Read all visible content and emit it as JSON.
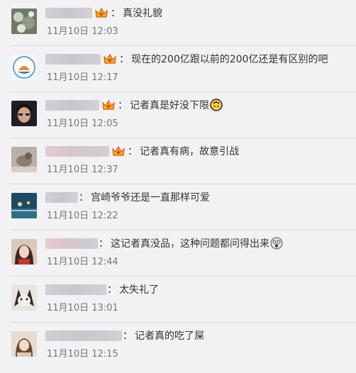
{
  "comments": [
    {
      "separator": "：",
      "text": "真没礼貌",
      "time": "11月10日 12:03",
      "badge": "vip-crown-badge",
      "emoji": ""
    },
    {
      "separator": "：",
      "text": "现在的200亿跟以前的200亿还是有区别的吧",
      "time": "11月10日 12:17",
      "badge": "vip-crown-badge",
      "emoji": ""
    },
    {
      "separator": "：",
      "text": "记者真是好没下限",
      "time": "11月10日 12:05",
      "badge": "vip-crown-badge",
      "emoji": "upside-down-face-emoji"
    },
    {
      "separator": "：",
      "text": "记者真有病，故意引战",
      "time": "11月10日 12:37",
      "badge": "vip-crown-badge",
      "emoji": ""
    },
    {
      "separator": "：",
      "text": "宫崎爷爷还是一直那样可爱",
      "time": "11月10日 12:22",
      "badge": "",
      "emoji": ""
    },
    {
      "separator": "：",
      "text": "这记者真没品，这种问题都问得出来",
      "time": "11月10日 12:44",
      "badge": "",
      "emoji": "shocked-face-emoji"
    },
    {
      "separator": "：",
      "text": "太失礼了",
      "time": "11月10日 13:01",
      "badge": "",
      "emoji": ""
    },
    {
      "separator": "：",
      "text": "记者真的吃了屎",
      "time": "11月10日 12:15",
      "badge": "",
      "emoji": ""
    }
  ],
  "colors": {
    "background": "#f2f2f5",
    "text": "#333333",
    "time": "#777777",
    "divider": "#dcdce0",
    "badge": "#f7b500"
  }
}
